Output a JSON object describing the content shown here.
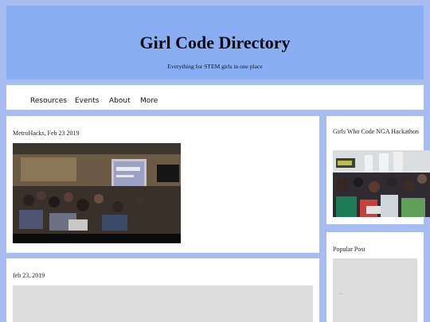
{
  "header": {
    "title": "Girl Code Directory",
    "tagline": "Everything for STEM girls in one place"
  },
  "nav": {
    "items": [
      {
        "label": "Resources"
      },
      {
        "label": "Events"
      },
      {
        "label": "About"
      },
      {
        "label": "More"
      }
    ]
  },
  "posts": [
    {
      "title": "MetroHacks, Feb 23 2019"
    },
    {
      "title": "feb 23, 2019"
    }
  ],
  "sidebar": {
    "featured_title": "Girls Who Code NGA Hackathon",
    "popular_heading": "Popular Post",
    "popular_snippet": ".."
  },
  "colors": {
    "page_background": "#a7bdf2",
    "header_background": "#8aaef4",
    "card_background": "#ffffff",
    "placeholder": "#dcdcdc"
  }
}
